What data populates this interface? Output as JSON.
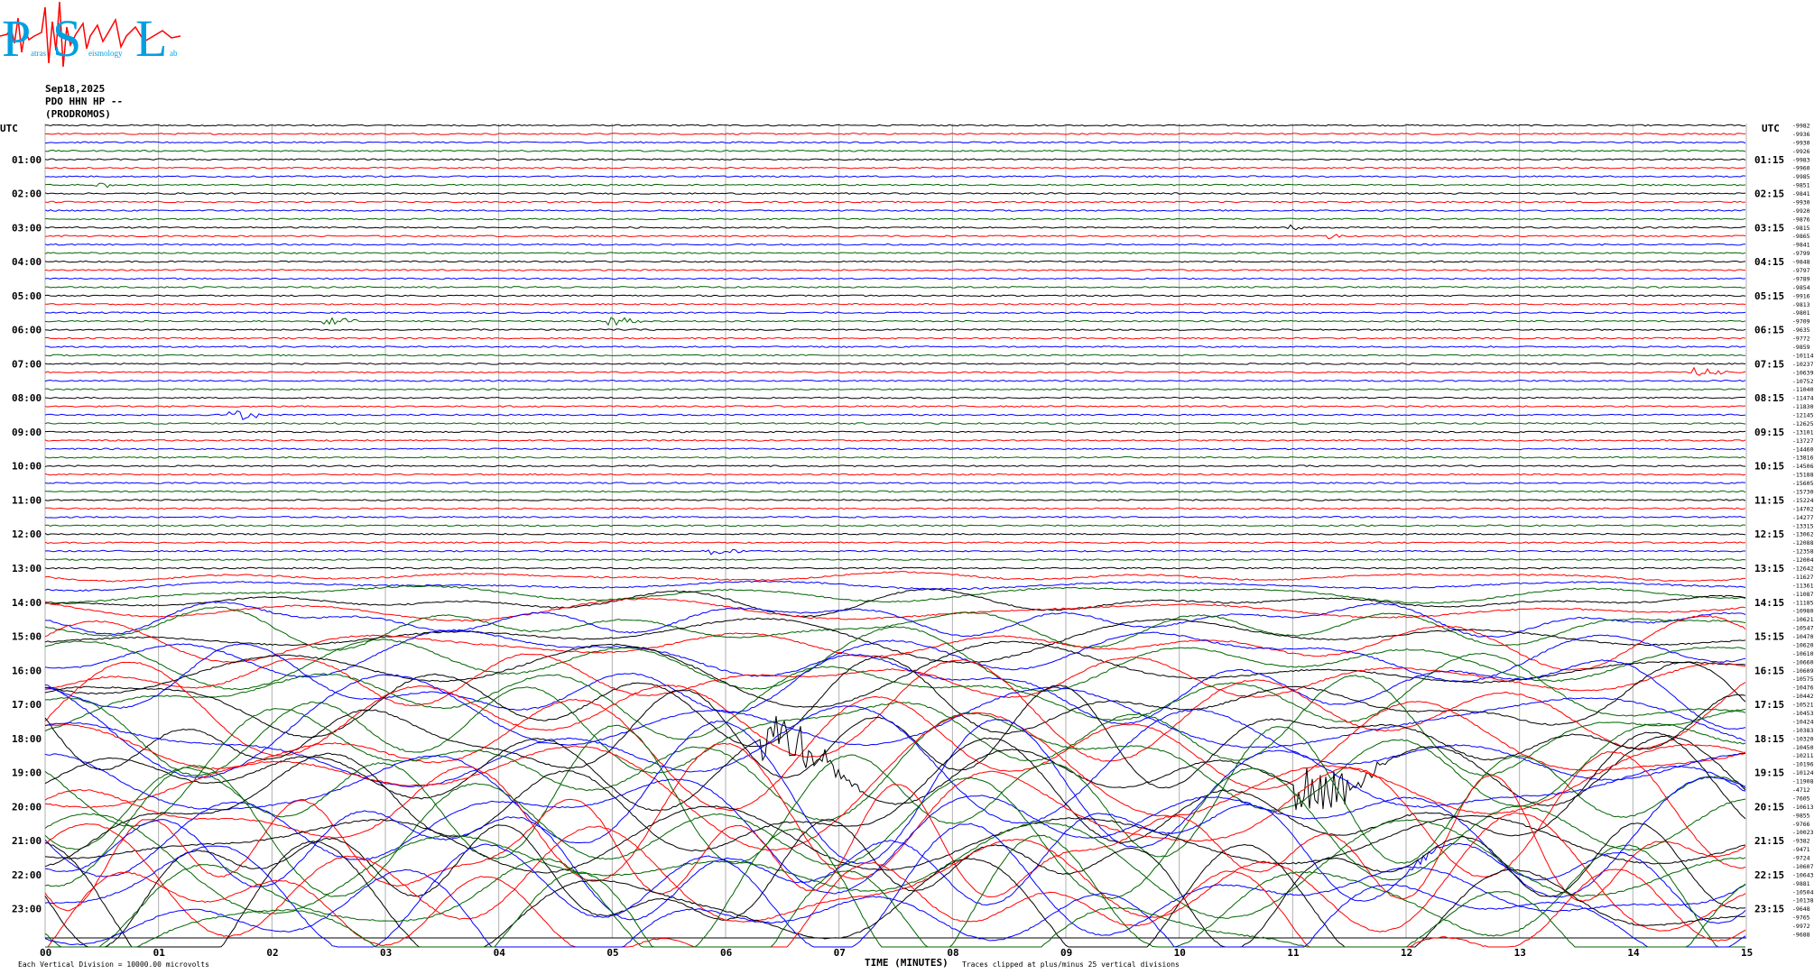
{
  "logo": {
    "letters": [
      "P",
      "S",
      "L"
    ],
    "words": [
      "atras",
      "eismology",
      "ab"
    ],
    "colors": {
      "text": "#00a0e0",
      "wave": "#ff0000"
    }
  },
  "header": {
    "date": "Sep18,2025",
    "channel": "PDO HHN HP --",
    "station": "(PRODROMOS)"
  },
  "left_axis_title": "UTC",
  "right_axis_title": "UTC",
  "hour_labels_left": [
    "01:00",
    "02:00",
    "03:00",
    "04:00",
    "05:00",
    "06:00",
    "07:00",
    "08:00",
    "09:00",
    "10:00",
    "11:00",
    "12:00",
    "13:00",
    "14:00",
    "15:00",
    "16:00",
    "17:00",
    "18:00",
    "19:00",
    "20:00",
    "21:00",
    "22:00",
    "23:00"
  ],
  "hour_labels_right": [
    "01:15",
    "02:15",
    "03:15",
    "04:15",
    "05:15",
    "06:15",
    "07:15",
    "08:15",
    "09:15",
    "10:15",
    "11:15",
    "12:15",
    "13:15",
    "14:15",
    "15:15",
    "16:15",
    "17:15",
    "18:15",
    "19:15",
    "20:15",
    "21:15",
    "22:15",
    "23:15"
  ],
  "minute_labels": [
    "00",
    "01",
    "02",
    "03",
    "04",
    "05",
    "06",
    "07",
    "08",
    "09",
    "10",
    "11",
    "12",
    "13",
    "14",
    "15"
  ],
  "x_axis_label": "TIME (MINUTES)",
  "footer_left": "Each Vertical Division = 10000.00 microvolts",
  "footer_right": "Traces clipped at plus/minus 25 vertical divisions",
  "chart_data": {
    "type": "line",
    "title": "Sep18,2025 PDO HHN HP -- (PRODROMOS)",
    "xlabel": "TIME (MINUTES)",
    "ylabel": "UTC",
    "xlim": [
      0,
      15
    ],
    "x_ticks": [
      "00",
      "01",
      "02",
      "03",
      "04",
      "05",
      "06",
      "07",
      "08",
      "09",
      "10",
      "11",
      "12",
      "13",
      "14",
      "15"
    ],
    "traces_per_hour": 4,
    "trace_count": 96,
    "trace_colors": [
      "#000000",
      "#ff0000",
      "#0000ff",
      "#006400"
    ],
    "trace_offsets": [
      -9982,
      -9936,
      -9930,
      -9926,
      -9983,
      -9960,
      -9985,
      -9851,
      -9841,
      -9930,
      -9920,
      -9876,
      -9815,
      -9865,
      -9841,
      -9799,
      -9848,
      -9797,
      -9789,
      -9854,
      -9916,
      -9813,
      -9801,
      -9709,
      -9635,
      -9772,
      -9859,
      -10114,
      -10237,
      -10639,
      -10752,
      -11040,
      -11474,
      -11830,
      -12145,
      -12625,
      -13101,
      -13727,
      -14460,
      -13816,
      -14506,
      -15188,
      -15605,
      -15730,
      -15224,
      -14702,
      -14277,
      -13315,
      -13062,
      -12088,
      -12358,
      -12004,
      -12642,
      -11627,
      -11361,
      -11087,
      -11185,
      -10980,
      -10621,
      -10547,
      -10470,
      -10620,
      -10610,
      -10660,
      -10609,
      -10575,
      -10476,
      -10442,
      -10521,
      -10453,
      -10424,
      -10383,
      -10320,
      -10450,
      -10211,
      -10196,
      -10124,
      -11908,
      -4712,
      -7605,
      -10613,
      -9855,
      -9766,
      -10023,
      -9382,
      -9471,
      -9724,
      -10607,
      -10643,
      -9881,
      -10504,
      -10138,
      -9648,
      -9765,
      -9972,
      -9688
    ],
    "events": [
      {
        "trace": 7,
        "minute": 0.5,
        "amplitude": "small"
      },
      {
        "trace": 12,
        "minute": 11.0,
        "amplitude": "small"
      },
      {
        "trace": 13,
        "minute": 11.35,
        "amplitude": "small"
      },
      {
        "trace": 23,
        "minute": 2.5,
        "amplitude": "medium"
      },
      {
        "trace": 23,
        "minute": 5.0,
        "amplitude": "medium"
      },
      {
        "trace": 29,
        "minute": 14.6,
        "amplitude": "medium"
      },
      {
        "trace": 34,
        "minute": 1.7,
        "amplitude": "medium"
      },
      {
        "trace": 50,
        "minute": 5.9,
        "amplitude": "medium"
      },
      {
        "trace": 76,
        "minute": 6.5,
        "amplitude": "large"
      },
      {
        "trace": 76,
        "minute": 11.2,
        "amplitude": "large"
      },
      {
        "trace": 86,
        "minute": 12.1,
        "amplitude": "medium"
      }
    ],
    "clipped_from_trace": 53,
    "clip_level_divisions": 25,
    "vertical_division_microvolts": 10000.0,
    "grid": true
  }
}
